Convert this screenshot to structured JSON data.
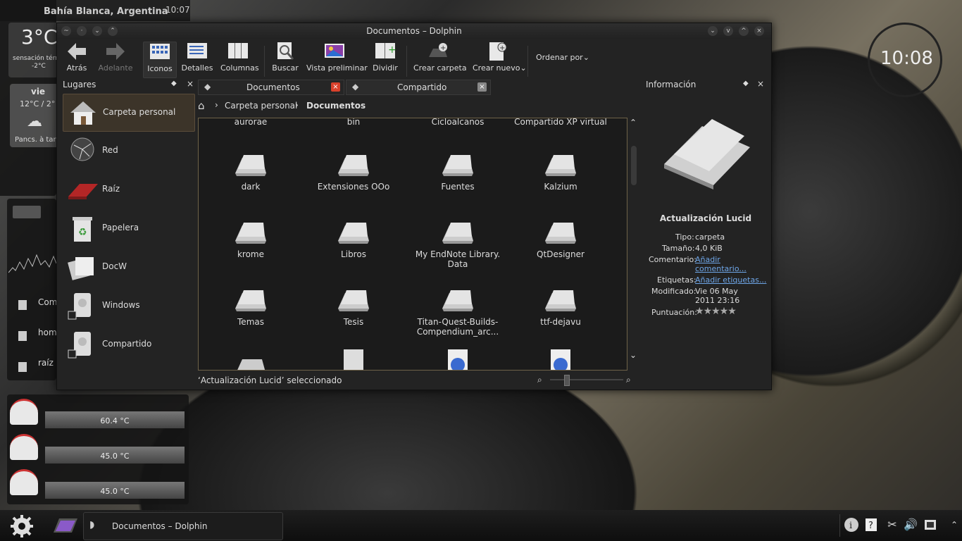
{
  "desktop": {
    "weather": {
      "city": "Bahía Blanca, Argentina",
      "time": "10:07",
      "temperature": "3°C",
      "feels_like_label": "sensación térm",
      "feels_like_value": "-2°C",
      "forecast_day": "vie",
      "forecast_range": "12°C / 2°",
      "forecast_note": "Pancs. à tar"
    },
    "clock": "10:08",
    "left_items": [
      "Com",
      "hom",
      "raíz"
    ],
    "gauges": [
      "60.4 °C",
      "45.0 °C",
      "45.0 °C"
    ]
  },
  "window": {
    "title": "Documentos – Dolphin",
    "toolbar": [
      {
        "label": "Atrás",
        "icon": "back-arrow-icon"
      },
      {
        "label": "Adelante",
        "icon": "forward-arrow-icon",
        "disabled": true
      },
      {
        "label": "Iconos",
        "icon": "icons-view-icon",
        "selected": true
      },
      {
        "label": "Detalles",
        "icon": "details-view-icon"
      },
      {
        "label": "Columnas",
        "icon": "columns-view-icon"
      },
      {
        "label": "Buscar",
        "icon": "search-icon"
      },
      {
        "label": "Vista preliminar",
        "icon": "preview-icon"
      },
      {
        "label": "Dividir",
        "icon": "split-icon"
      },
      {
        "label": "Crear carpeta",
        "icon": "new-folder-icon"
      },
      {
        "label": "Crear nuevo",
        "icon": "create-new-icon"
      }
    ],
    "sort_label": "Ordenar por",
    "places": {
      "header": "Lugares",
      "items": [
        {
          "label": "Carpeta personal",
          "selected": true
        },
        {
          "label": "Red"
        },
        {
          "label": "Raíz"
        },
        {
          "label": "Papelera"
        },
        {
          "label": "DocW"
        },
        {
          "label": "Windows"
        },
        {
          "label": "Compartido"
        }
      ]
    },
    "tabs": [
      {
        "label": "Documentos",
        "active": true
      },
      {
        "label": "Compartido"
      }
    ],
    "breadcrumb": [
      "Carpeta personal",
      "Documentos"
    ],
    "files_top_row": [
      "aurorae",
      "bin",
      "Cicloalcanos",
      "Compartido XP virtual"
    ],
    "files": [
      {
        "name": "dark"
      },
      {
        "name": "Extensiones OOo"
      },
      {
        "name": "Fuentes"
      },
      {
        "name": "Kalzium"
      },
      {
        "name": "krome"
      },
      {
        "name": "Libros"
      },
      {
        "name": "My EndNote Library.\nData"
      },
      {
        "name": "QtDesigner"
      },
      {
        "name": "Temas"
      },
      {
        "name": "Tesis"
      },
      {
        "name": "Titan-Quest-Builds-\nCompendium_arc..."
      },
      {
        "name": "ttf-dejavu"
      }
    ],
    "status": "‘Actualización Lucid’ seleccionado",
    "info": {
      "header": "Información",
      "name": "Actualización Lucid",
      "tipo_label": "Tipo:",
      "tipo": "carpeta",
      "tamano_label": "Tamaño:",
      "tamano": "4,0 KiB",
      "comentario_label": "Comentario:",
      "comentario": "Añadir comentario...",
      "etiquetas_label": "Etiquetas:",
      "etiquetas": "Añadir etiquetas...",
      "modificado_label": "Modificado:",
      "modificado": "Vie 06 May 2011 23:16",
      "puntuacion_label": "Puntuación:",
      "puntuacion_stars": 5
    }
  },
  "taskbar": {
    "task_label": "Documentos – Dolphin"
  },
  "colors": {
    "accent": "#6ea6e8",
    "close_red": "#d9412b",
    "selection": "#3c3429"
  }
}
